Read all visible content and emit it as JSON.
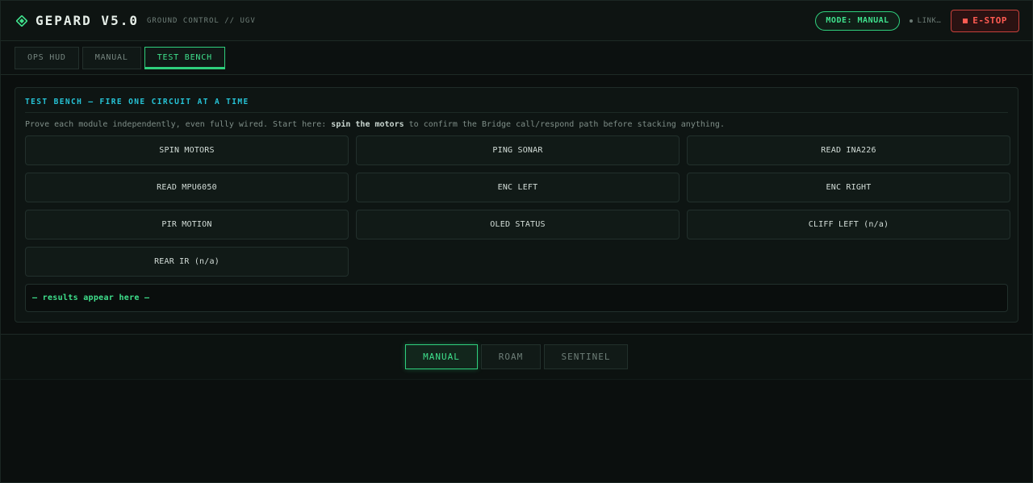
{
  "header": {
    "brand": "GEPARD V5.0",
    "subtitle": "GROUND CONTROL // UGV",
    "mode_pill": "MODE: MANUAL",
    "link_status": "LINK…",
    "estop_label": "E-STOP"
  },
  "tabs": [
    {
      "label": "OPS HUD",
      "active": false
    },
    {
      "label": "MANUAL",
      "active": false
    },
    {
      "label": "TEST BENCH",
      "active": true
    }
  ],
  "test_bench": {
    "title": "TEST BENCH — FIRE ONE CIRCUIT AT A TIME",
    "desc_before": "Prove each module independently, even fully wired. Start here: ",
    "desc_bold": "spin the motors",
    "desc_after": " to confirm the Bridge call/respond path before stacking anything.",
    "buttons": [
      "SPIN MOTORS",
      "PING SONAR",
      "READ INA226",
      "READ MPU6050",
      "ENC LEFT",
      "ENC RIGHT",
      "PIR MOTION",
      "OLED STATUS",
      "CLIFF LEFT (n/a)",
      "REAR IR (n/a)"
    ],
    "results_placeholder": "— results appear here —"
  },
  "mode_buttons": [
    {
      "label": "MANUAL",
      "active": true
    },
    {
      "label": "ROAM",
      "active": false
    },
    {
      "label": "SENTINEL",
      "active": false
    }
  ],
  "colors": {
    "accent_green": "#3fe08c",
    "accent_cyan": "#26c3d6",
    "estop_red": "#ff5b52",
    "background": "#0b0f0e"
  },
  "icons": {
    "logo": "diamond-logo-icon",
    "estop": "stop-square-icon",
    "link": "status-dot-icon"
  }
}
